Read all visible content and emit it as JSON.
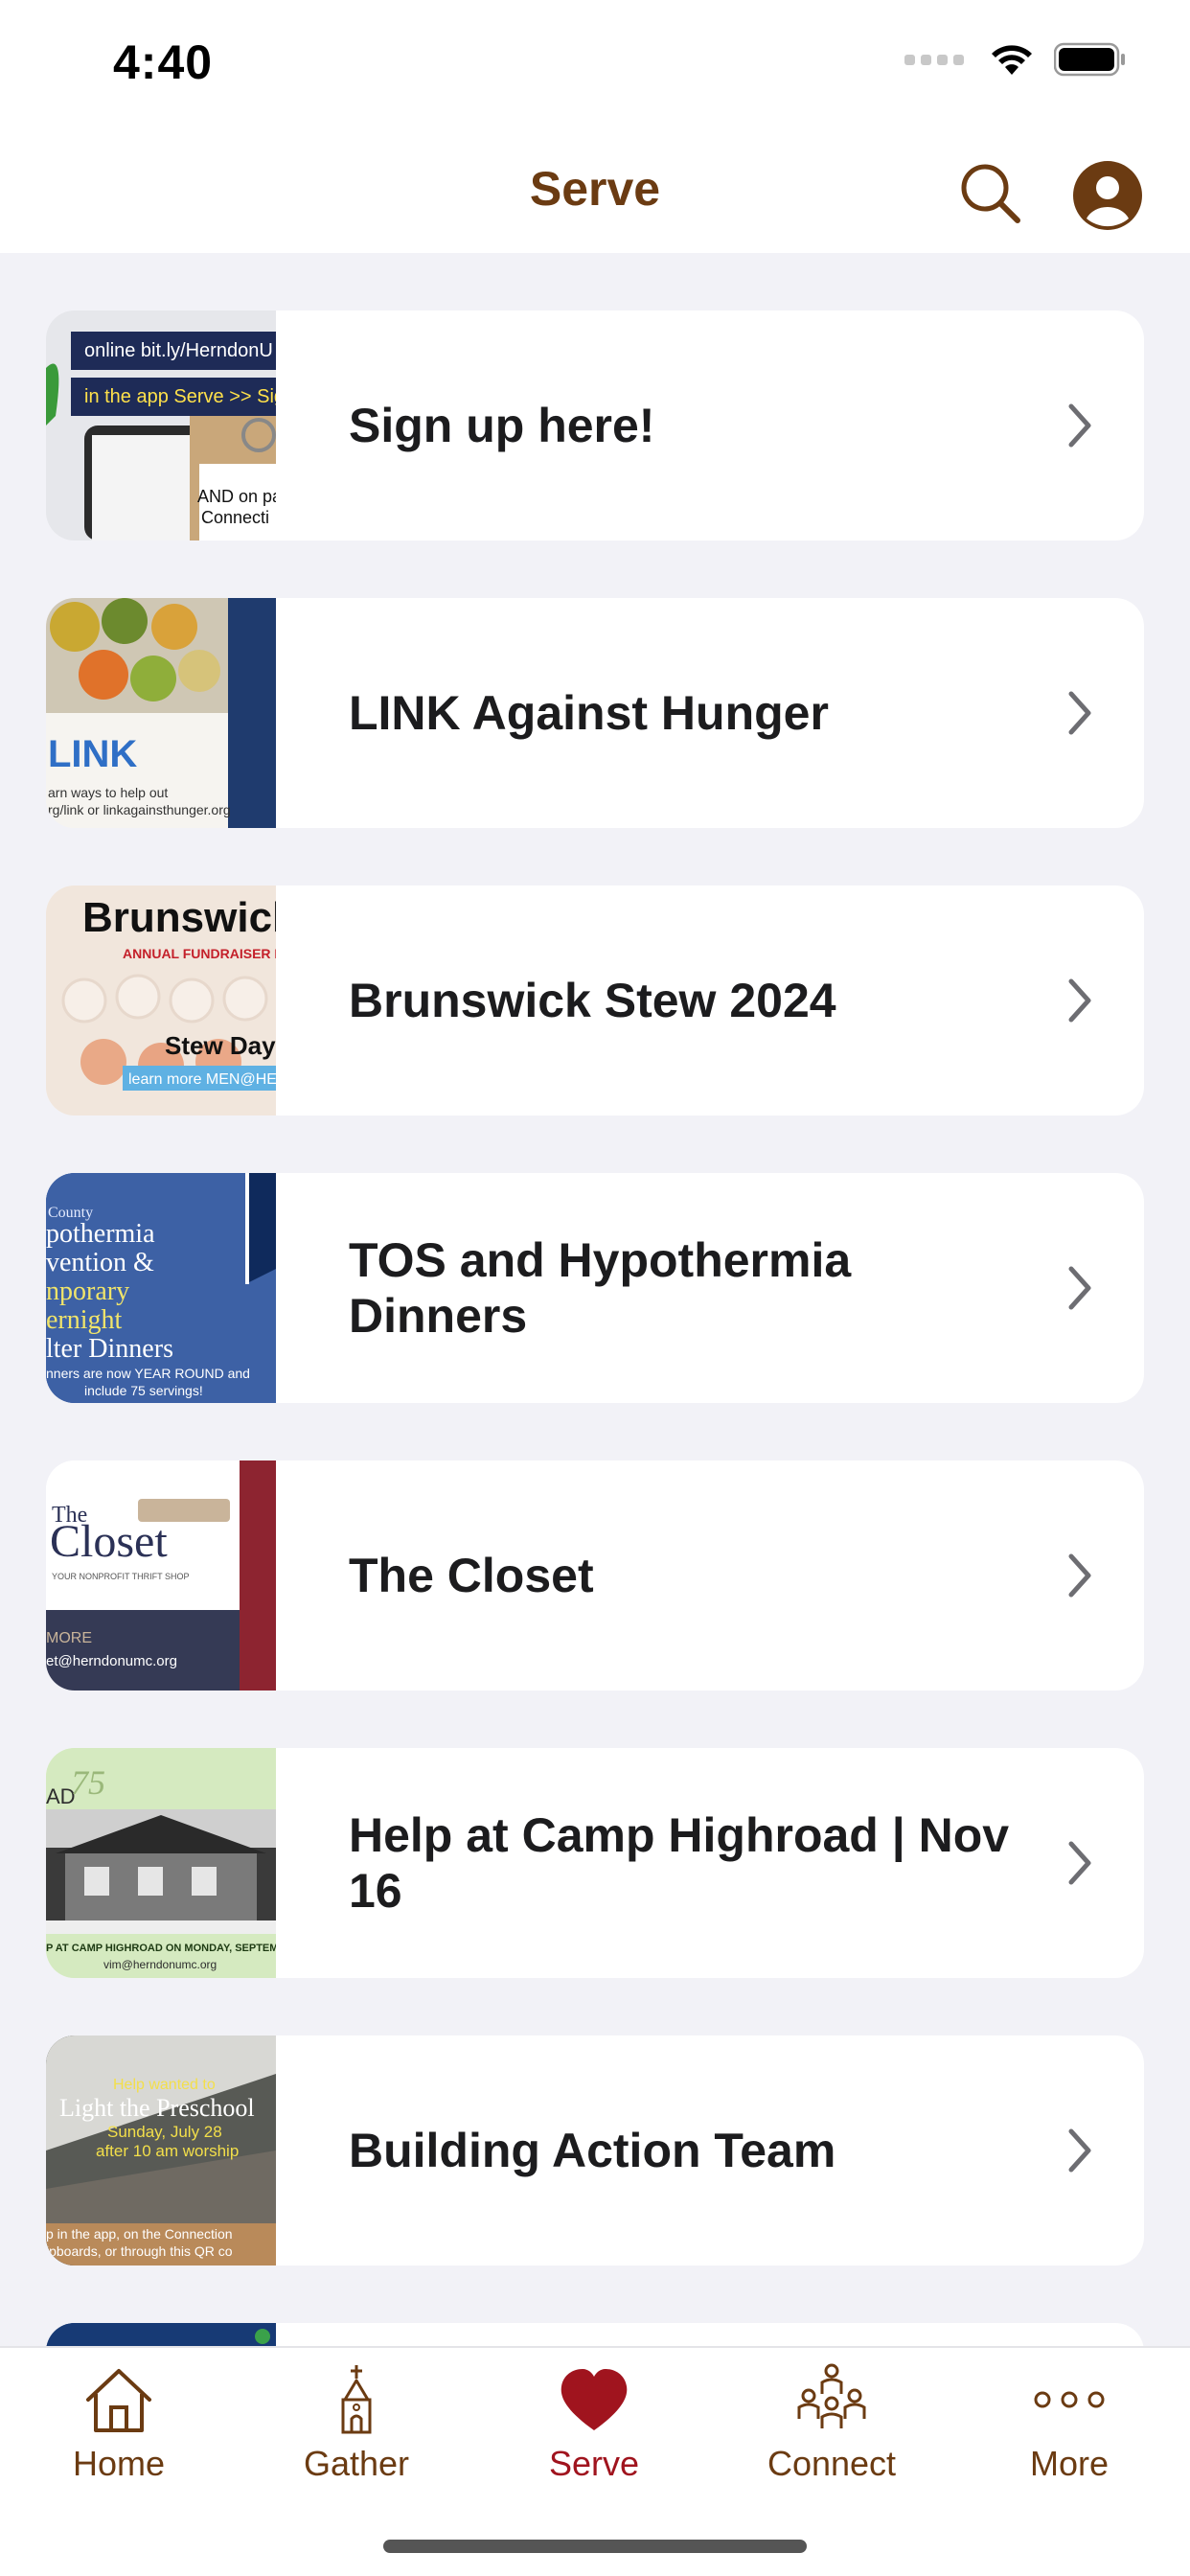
{
  "status_bar": {
    "time": "4:40"
  },
  "nav": {
    "title": "Serve",
    "search_icon": "search-icon",
    "profile_icon": "person-circle-icon"
  },
  "colors": {
    "brand": "#6b3b12",
    "active": "#a0141e",
    "background": "#f2f2f7"
  },
  "items": [
    {
      "label": "Sign up here!",
      "thumb_text": [
        "online bit.ly/HerndonU",
        "in the app Serve >> Sig",
        "AND on pa",
        "Connecti"
      ]
    },
    {
      "label": "LINK Against Hunger",
      "thumb_text": [
        "LINK",
        "arn ways to help out",
        "rg/link or linkagainsthunger.org"
      ]
    },
    {
      "label": "Brunswick Stew 2024",
      "thumb_text": [
        "Brunswick St",
        "ANNUAL FUNDRAISER FOR M",
        "Stew Day is",
        "learn more MEN@HERNDO"
      ]
    },
    {
      "label": "TOS and Hypothermia Dinners",
      "thumb_text": [
        "County",
        "pothermia",
        "vention &",
        "nporary",
        "ernight",
        "lter Dinners",
        "nners are now YEAR ROUND and",
        "include 75 servings!"
      ]
    },
    {
      "label": "The Closet",
      "thumb_text": [
        "The",
        "Closet",
        "YOUR NONPROFIT THRIFT SHOP",
        "MORE",
        "et@herndonumc.org"
      ]
    },
    {
      "label": "Help at Camp Highroad | Nov 16",
      "thumb_text": [
        "AD",
        "75",
        "P AT CAMP HIGHROAD ON MONDAY, SEPTEMBE",
        "vim@herndonumc.org"
      ]
    },
    {
      "label": "Building Action Team",
      "thumb_text": [
        "Help wanted to",
        "Light the Preschool",
        "Sunday, July 28",
        "after 10 am worship",
        "p in the app, on the Connection",
        "ipboards, or through this QR co"
      ]
    }
  ],
  "tabs": [
    {
      "label": "Home",
      "icon": "house-icon",
      "active": false
    },
    {
      "label": "Gather",
      "icon": "church-icon",
      "active": false
    },
    {
      "label": "Serve",
      "icon": "heart-icon",
      "active": true
    },
    {
      "label": "Connect",
      "icon": "people-group-icon",
      "active": false
    },
    {
      "label": "More",
      "icon": "more-dots-icon",
      "active": false
    }
  ]
}
